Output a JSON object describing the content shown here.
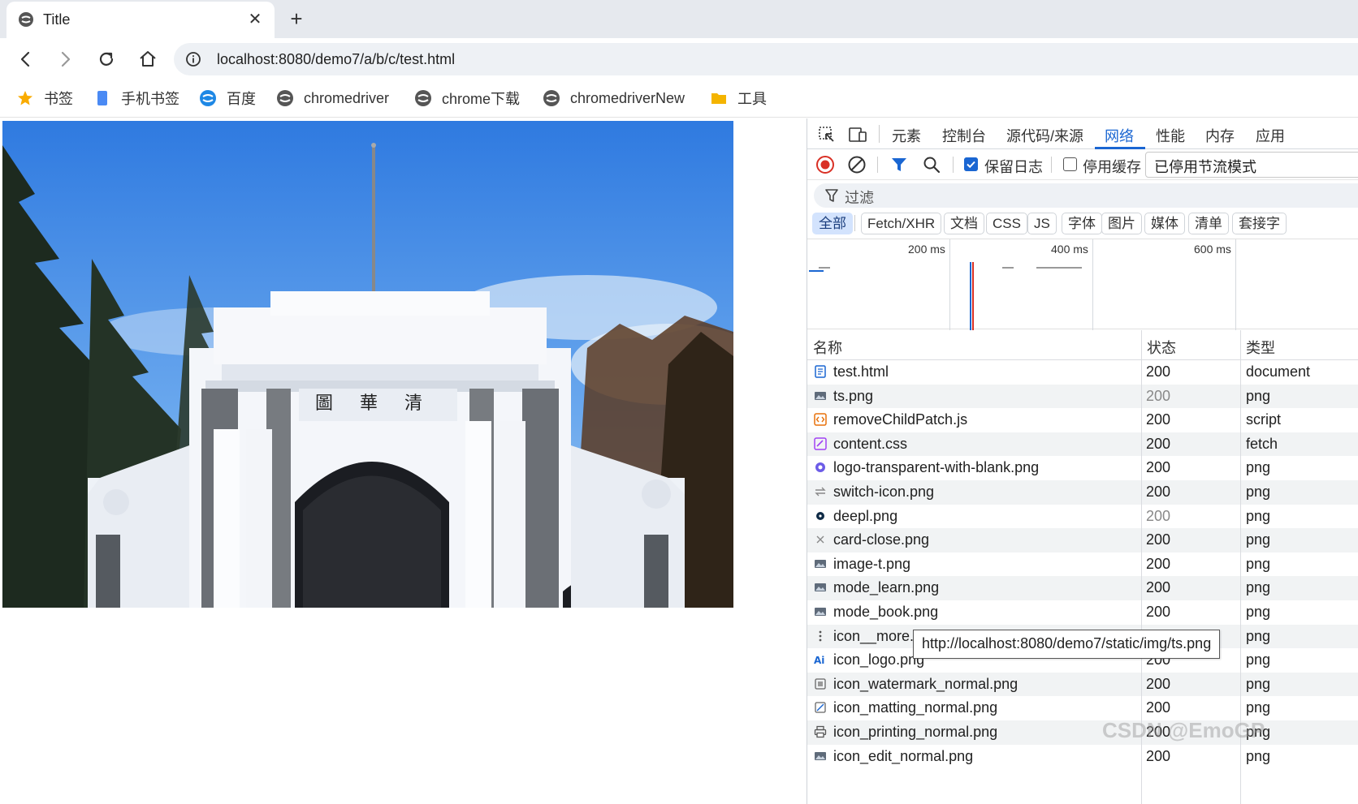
{
  "tab": {
    "title": "Title",
    "close_glyph": "✕",
    "new_tab_glyph": "+"
  },
  "toolbar": {
    "icons": [
      "back-arrow-icon",
      "forward-arrow-icon",
      "reload-icon",
      "home-icon"
    ],
    "url": "localhost:8080/demo7/a/b/c/test.html"
  },
  "bookmarks": [
    {
      "label": "书签",
      "icon": "star-icon"
    },
    {
      "label": "手机书签",
      "icon": "phone-bookmark-icon"
    },
    {
      "label": "百度",
      "icon": "baidu-icon"
    },
    {
      "label": "chromedriver",
      "icon": "site-icon"
    },
    {
      "label": "chrome下载",
      "icon": "site-icon"
    },
    {
      "label": "chromedriverNew",
      "icon": "site-icon"
    },
    {
      "label": "工具",
      "icon": "folder-icon"
    }
  ],
  "devtools": {
    "tabs": [
      "元素",
      "控制台",
      "源代码/来源",
      "网络",
      "性能",
      "内存",
      "应用"
    ],
    "active_tab": "网络",
    "preserve_log_label": "保留日志",
    "preserve_log_checked": true,
    "disable_cache_label": "停用缓存",
    "disable_cache_checked": false,
    "throttle_value": "已停用节流模式",
    "filter_placeholder": "过滤",
    "type_filters": [
      "全部",
      "Fetch/XHR",
      "文档",
      "CSS",
      "JS",
      "字体",
      "图片",
      "媒体",
      "清单",
      "套接字"
    ],
    "overview_ticks": [
      "200 ms",
      "400 ms",
      "600 ms"
    ],
    "columns": [
      "名称",
      "状态",
      "类型"
    ],
    "rows": [
      {
        "name": "test.html",
        "status": "200",
        "type": "document",
        "icon": "document-icon",
        "dim": false
      },
      {
        "name": "ts.png",
        "status": "200",
        "type": "png",
        "icon": "image-icon",
        "dim": true
      },
      {
        "name": "removeChildPatch.js",
        "status": "200",
        "type": "script",
        "icon": "script-icon",
        "dim": false
      },
      {
        "name": "content.css",
        "status": "200",
        "type": "fetch",
        "icon": "stylesheet-icon",
        "dim": false
      },
      {
        "name": "logo-transparent-with-blank.png",
        "status": "200",
        "type": "png",
        "icon": "logo-icon",
        "dim": false
      },
      {
        "name": "switch-icon.png",
        "status": "200",
        "type": "png",
        "icon": "switch-icon",
        "dim": false
      },
      {
        "name": "deepl.png",
        "status": "200",
        "type": "png",
        "icon": "deepl-icon",
        "dim": true
      },
      {
        "name": "card-close.png",
        "status": "200",
        "type": "png",
        "icon": "close-icon",
        "dim": false
      },
      {
        "name": "image-t.png",
        "status": "200",
        "type": "png",
        "icon": "image-icon",
        "dim": false
      },
      {
        "name": "mode_learn.png",
        "status": "200",
        "type": "png",
        "icon": "image-icon",
        "dim": false
      },
      {
        "name": "mode_book.png",
        "status": "200",
        "type": "png",
        "icon": "image-icon",
        "dim": false
      },
      {
        "name": "icon__more.png",
        "status": "200",
        "type": "png",
        "icon": "more-icon",
        "dim": false
      },
      {
        "name": "icon_logo.png",
        "status": "200",
        "type": "png",
        "icon": "ai-icon",
        "dim": false
      },
      {
        "name": "icon_watermark_normal.png",
        "status": "200",
        "type": "png",
        "icon": "watermark-icon",
        "dim": false
      },
      {
        "name": "icon_matting_normal.png",
        "status": "200",
        "type": "png",
        "icon": "matting-icon",
        "dim": false
      },
      {
        "name": "icon_printing_normal.png",
        "status": "200",
        "type": "png",
        "icon": "printer-icon",
        "dim": false
      },
      {
        "name": "icon_edit_normal.png",
        "status": "200",
        "type": "png",
        "icon": "image-icon",
        "dim": false
      }
    ],
    "tooltip": "http://localhost:8080/demo7/static/img/ts.png"
  },
  "watermark": "CSDN @EmoGP",
  "colors": {
    "accent": "#1a66d2",
    "record_red": "#d93025",
    "tab_strip": "#e6e9ee"
  }
}
